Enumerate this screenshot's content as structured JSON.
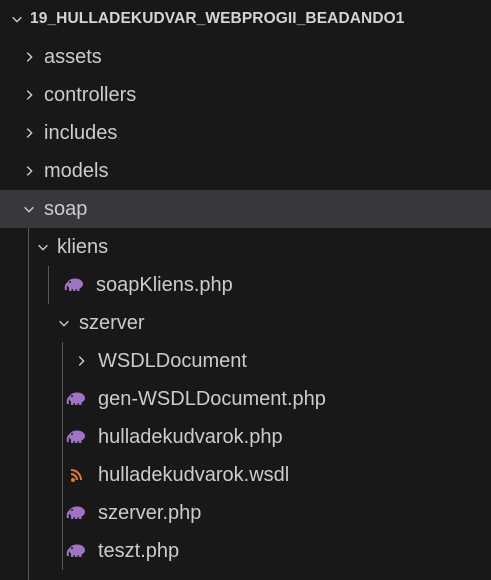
{
  "explorer": {
    "root_label": "19_HULLADEKUDVAR_WEBPROGII_BEADANDO1",
    "folders_top": {
      "assets": "assets",
      "controllers": "controllers",
      "includes": "includes",
      "models": "models",
      "soap": "soap"
    },
    "soap": {
      "kliens": "kliens",
      "kliens_files": {
        "soapkliens": "soapKliens.php"
      },
      "szerver": "szerver",
      "szerver_children": {
        "wsdldocument": "WSDLDocument",
        "gen_wsdldocument": "gen-WSDLDocument.php",
        "hulladekudvarok_php": "hulladekudvarok.php",
        "hulladekudvarok_wsdl": "hulladekudvarok.wsdl",
        "szerver_php": "szerver.php",
        "teszt_php": "teszt.php"
      }
    },
    "selected_item": "soap",
    "icons": {
      "php": "php-elephant-icon",
      "wsdl": "rss-icon",
      "expanded": "chevron-down-icon",
      "collapsed": "chevron-right-icon"
    },
    "colors": {
      "background": "#181818",
      "selected_row": "#37373d",
      "text": "#cccccc",
      "php_icon": "#a074c4",
      "wsdl_icon": "#e37933"
    }
  }
}
